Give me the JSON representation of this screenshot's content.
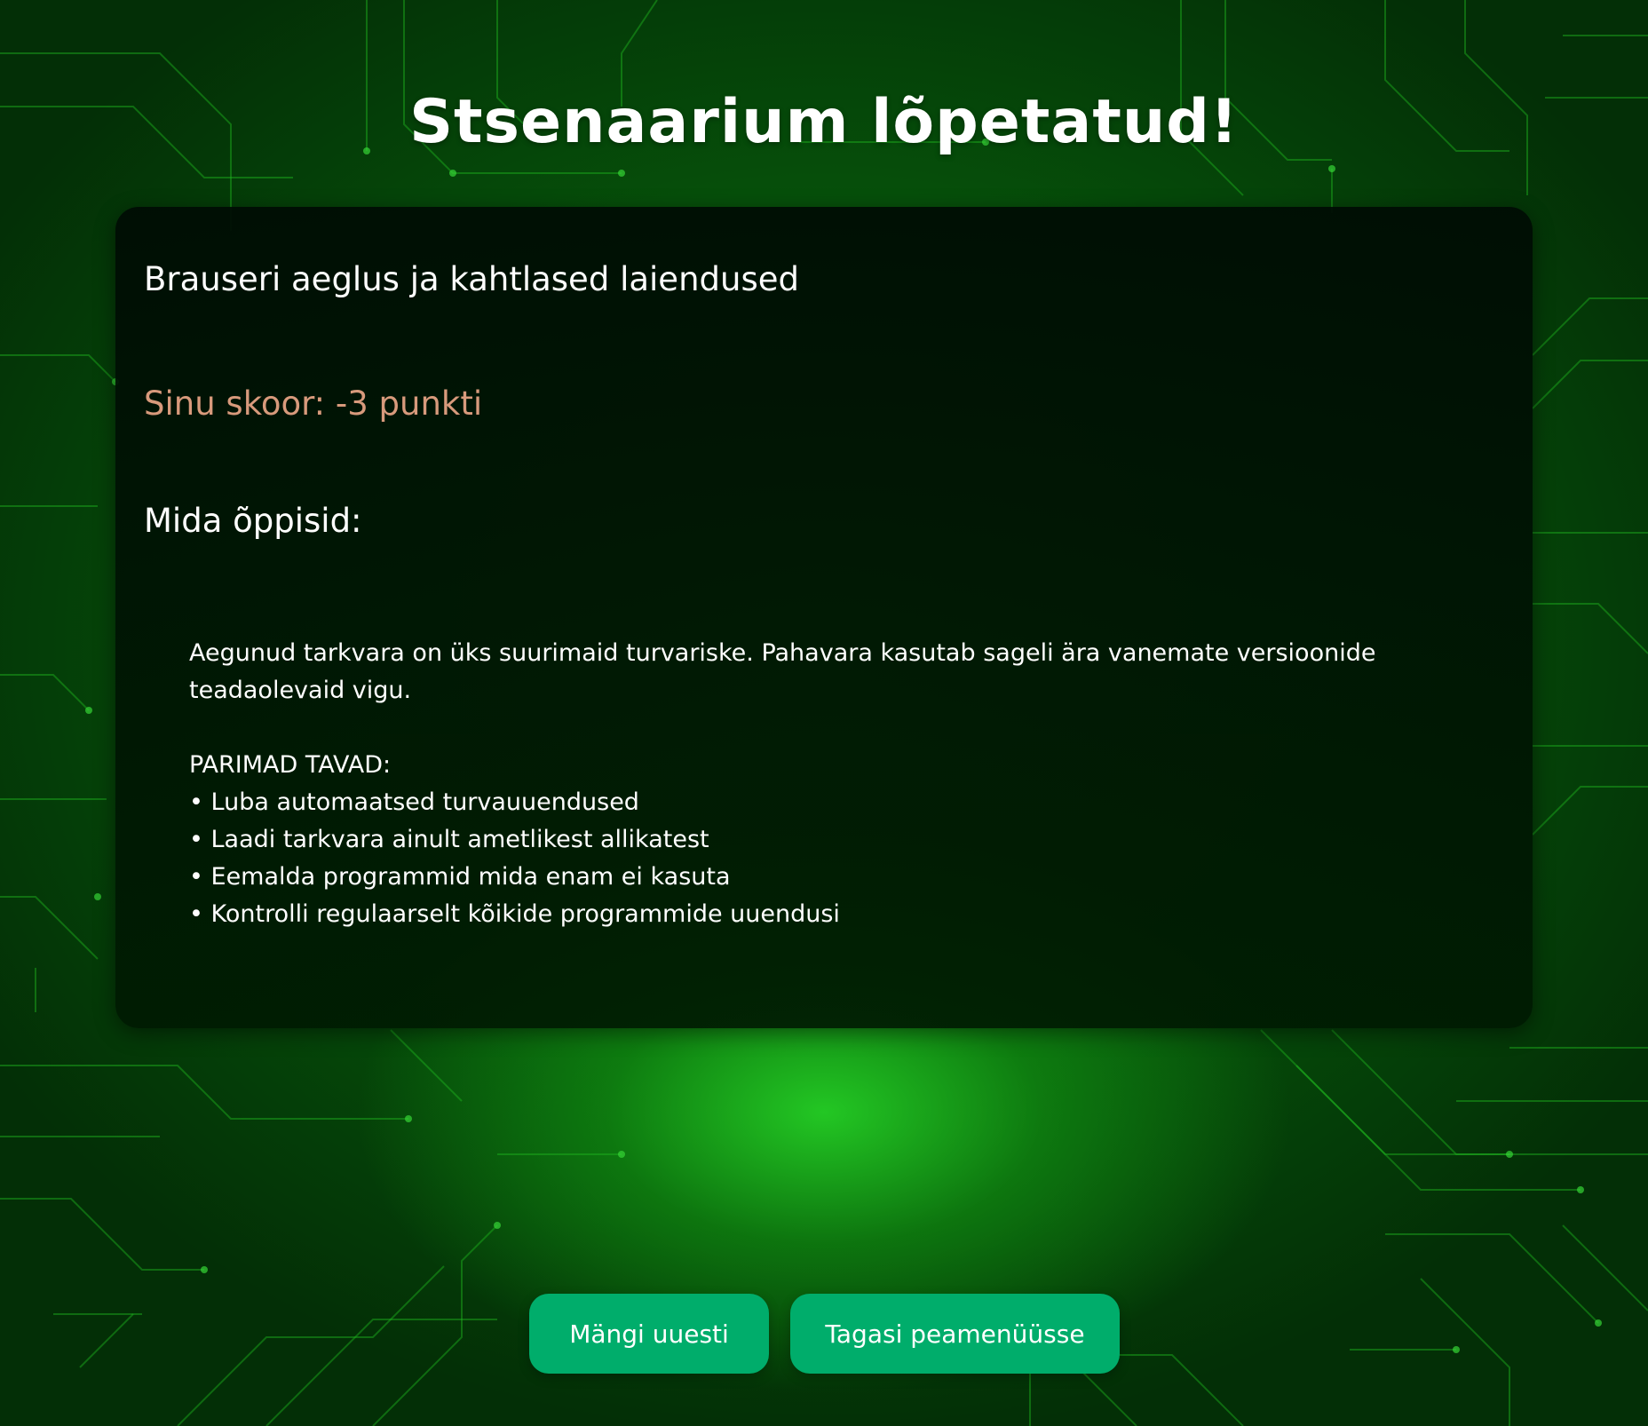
{
  "header": {
    "title": "Stsenaarium lõpetatud!"
  },
  "result_card": {
    "scenario_title": "Brauseri aeglus ja kahtlased laiendused",
    "score_text": "Sinu skoor: -3 punkti",
    "learned_heading": "Mida õppisid:",
    "lesson_text": "Aegunud tarkvara on üks suurimaid turvariske. Pahavara kasutab sageli ära vanemate versioonide teadaolevaid vigu.",
    "best_practices_heading": "PARIMAD TAVAD:",
    "best_practices": [
      "Luba automaatsed turvauuendused",
      "Laadi tarkvara ainult ametlikest allikatest",
      "Eemalda programmid mida enam ei kasuta",
      "Kontrolli regulaarselt kõikide programmide uuendusi"
    ]
  },
  "actions": {
    "replay_label": "Mängi uuesti",
    "main_menu_label": "Tagasi peamenüüsse"
  },
  "colors": {
    "button": "#00ad6b",
    "score_text": "#d89a7c",
    "background_green": "#0b7a10"
  }
}
